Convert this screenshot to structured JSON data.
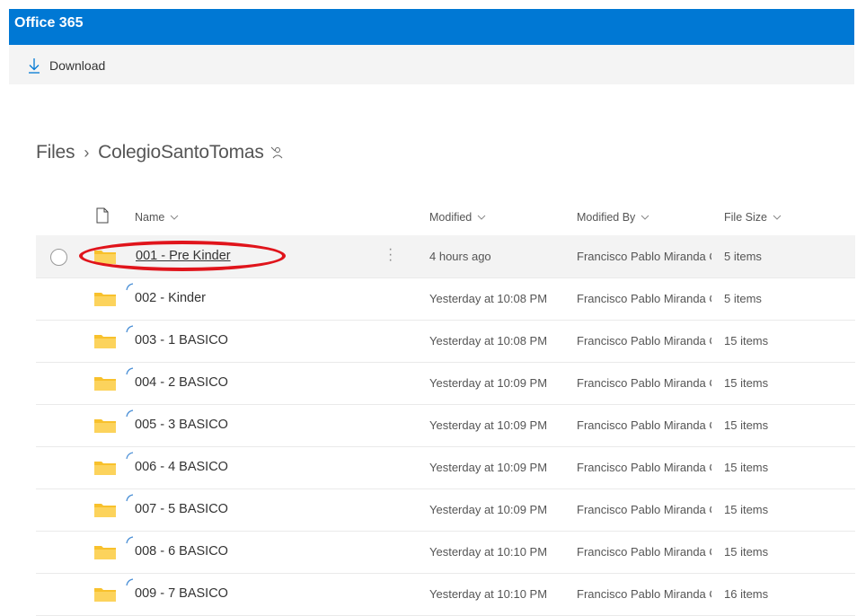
{
  "app": {
    "title": "Office 365"
  },
  "toolbar": {
    "download_label": "Download"
  },
  "breadcrumb": {
    "root": "Files",
    "current": "ColegioSantoTomas"
  },
  "columns": {
    "name": "Name",
    "modified": "Modified",
    "modified_by": "Modified By",
    "file_size": "File Size"
  },
  "rows": [
    {
      "name": "001 - Pre Kinder",
      "modified": "4 hours ago",
      "modified_by": "Francisco Pablo Miranda C",
      "size": "5 items",
      "selected": true
    },
    {
      "name": "002 - Kinder",
      "modified": "Yesterday at 10:08 PM",
      "modified_by": "Francisco Pablo Miranda C",
      "size": "5 items"
    },
    {
      "name": "003 - 1 BASICO",
      "modified": "Yesterday at 10:08 PM",
      "modified_by": "Francisco Pablo Miranda C",
      "size": "15 items"
    },
    {
      "name": "004 - 2 BASICO",
      "modified": "Yesterday at 10:09 PM",
      "modified_by": "Francisco Pablo Miranda C",
      "size": "15 items"
    },
    {
      "name": "005 - 3 BASICO",
      "modified": "Yesterday at 10:09 PM",
      "modified_by": "Francisco Pablo Miranda C",
      "size": "15 items"
    },
    {
      "name": "006 - 4 BASICO",
      "modified": "Yesterday at 10:09 PM",
      "modified_by": "Francisco Pablo Miranda C",
      "size": "15 items"
    },
    {
      "name": "007 - 5 BASICO",
      "modified": "Yesterday at 10:09 PM",
      "modified_by": "Francisco Pablo Miranda C",
      "size": "15 items"
    },
    {
      "name": "008 - 6 BASICO",
      "modified": "Yesterday at 10:10 PM",
      "modified_by": "Francisco Pablo Miranda C",
      "size": "15 items"
    },
    {
      "name": "009 - 7 BASICO",
      "modified": "Yesterday at 10:10 PM",
      "modified_by": "Francisco Pablo Miranda C",
      "size": "16 items"
    }
  ],
  "colors": {
    "brand": "#0078d4",
    "folder": "#f8c12c",
    "annotation": "#e0141b"
  }
}
